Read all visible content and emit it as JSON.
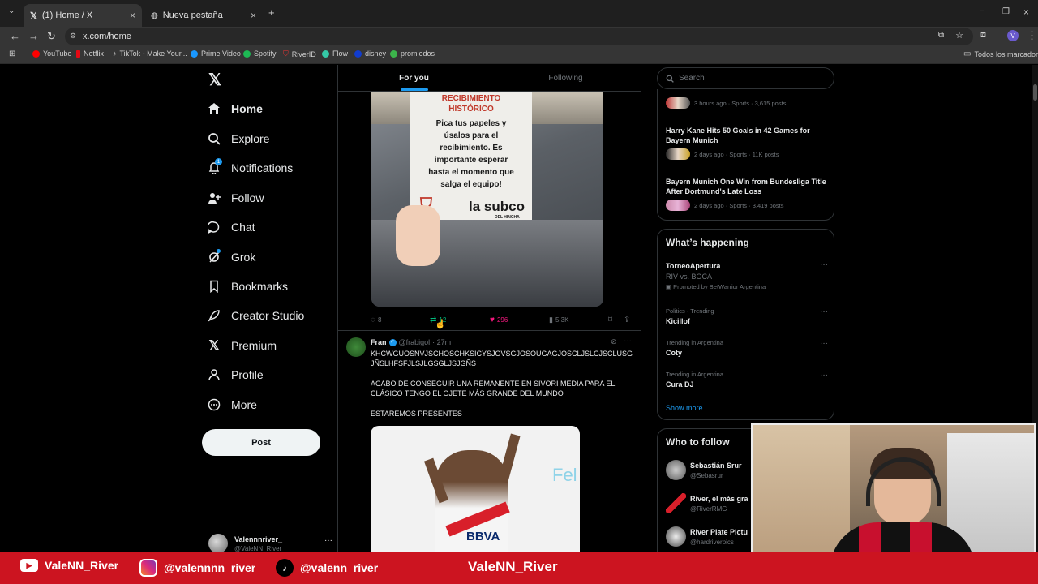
{
  "browser": {
    "tabs": [
      {
        "title": "(1) Home / X",
        "close": "×"
      },
      {
        "title": "Nueva pestaña",
        "close": "×"
      }
    ],
    "new_tab": "+",
    "url": "x.com/home",
    "window_controls": [
      "−",
      "❐",
      "×"
    ],
    "bookmarks": [
      {
        "label": "YouTube",
        "color": "#ff0000"
      },
      {
        "label": "Netflix",
        "color": "#e50914"
      },
      {
        "label": "TikTok - Make Your...",
        "color": "#111111"
      },
      {
        "label": "Prime Video",
        "color": "#1a98ff"
      },
      {
        "label": "Spotify",
        "color": "#1db954"
      },
      {
        "label": "RiverID",
        "color": "#ffffff"
      },
      {
        "label": "Flow",
        "color": "#35c9a7"
      },
      {
        "label": "disney",
        "color": "#113ccf"
      },
      {
        "label": "promiedos",
        "color": "#3cb44b"
      }
    ],
    "all_bookmarks": "Todos los marcadores"
  },
  "nav": {
    "items": [
      {
        "label": "Home",
        "icon": "home-icon",
        "active": true
      },
      {
        "label": "Explore",
        "icon": "search-icon"
      },
      {
        "label": "Notifications",
        "icon": "bell-icon",
        "badge": "1"
      },
      {
        "label": "Follow",
        "icon": "person-add-icon"
      },
      {
        "label": "Chat",
        "icon": "chat-icon"
      },
      {
        "label": "Grok",
        "icon": "grok-icon"
      },
      {
        "label": "Bookmarks",
        "icon": "bookmark-icon"
      },
      {
        "label": "Creator Studio",
        "icon": "rocket-icon"
      },
      {
        "label": "Premium",
        "icon": "x-logo-icon"
      },
      {
        "label": "Profile",
        "icon": "person-icon"
      },
      {
        "label": "More",
        "icon": "more-circle-icon"
      }
    ],
    "post_label": "Post",
    "account_name": "Valennnriver_",
    "account_handle": "@ValeNN_River"
  },
  "feed": {
    "tabs": [
      {
        "label": "For you",
        "active": true
      },
      {
        "label": "Following"
      }
    ],
    "tweet1": {
      "image_text": {
        "header": [
          "RECIBIMIENTO",
          "HISTÓRICO"
        ],
        "body": [
          "Pica tus papeles y",
          "úsalos para el",
          "recibimiento. Es",
          "importante esperar",
          "hasta el momento que",
          "salga el equipo!"
        ],
        "brand": "la subco",
        "brand_sub": "DEL HINCHA"
      },
      "replies": "8",
      "reposts": "12",
      "likes": "296",
      "views": "5.3K"
    },
    "tweet2": {
      "name": "Fran",
      "handle": "@frabigol",
      "time": "· 27m",
      "text_line1": "KHCWGUOSÑVJSCHOSCHKSICYSJOVSGJOSOUGAGJOSCLJSLCJSCLUSGJÑSLHFSFJLSJLGSGLJSJGÑS",
      "text_para2": "ACABO DE CONSEGUIR UNA REMANENTE EN SIVORI MEDIA PARA EL CLÁSICO TENGO EL OJETE MÁS GRANDE DEL MUNDO",
      "text_para3": "ESTAREMOS PRESENTES",
      "image_text": "BBVA",
      "image_side": "Fel"
    }
  },
  "sidebar": {
    "search_placeholder": "Search",
    "news": [
      {
        "title": "",
        "meta": "3 hours ago · Sports · 3,615 posts"
      },
      {
        "title": "Harry Kane Hits 50 Goals in 42 Games for Bayern Munich",
        "meta": "2 days ago · Sports · 11K posts"
      },
      {
        "title": "Bayern Munich One Win from Bundesliga Title After Dortmund's Late Loss",
        "meta": "2 days ago · Sports · 3,419 posts"
      }
    ],
    "happening_title": "What’s happening",
    "trends": [
      {
        "category": "",
        "name": "TorneoApertura",
        "sub": "RIV vs. BOCA",
        "promo": "Promoted by BetWarrior Argentina"
      },
      {
        "category": "Politics · Trending",
        "name": "Kicillof"
      },
      {
        "category": "Trending in Argentina",
        "name": "Coty"
      },
      {
        "category": "Trending in Argentina",
        "name": "Cura DJ"
      }
    ],
    "show_more": "Show more",
    "follow_title": "Who to follow",
    "follow": [
      {
        "name": "Sebastián Srur",
        "handle": "@Sebasrur"
      },
      {
        "name": "River, el más gra",
        "handle": "@RiverRMG"
      },
      {
        "name": "River Plate Pictu",
        "handle": "@hardriverpics"
      }
    ]
  },
  "overlay": {
    "youtube": "ValeNN_River",
    "instagram": "@valennnn_river",
    "tiktok": "@valenn_river",
    "center": "ValeNN_River"
  }
}
